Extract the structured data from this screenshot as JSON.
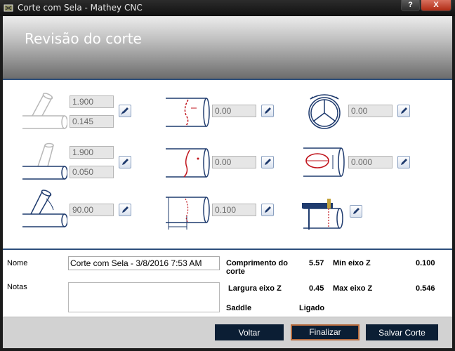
{
  "window": {
    "title": "Corte com Sela - Mathey CNC",
    "help_label": "?",
    "close_label": "X"
  },
  "page": {
    "title": "Revisão do corte"
  },
  "fields": {
    "r1c1_a": "1.900",
    "r1c1_b": "0.145",
    "r2c1_a": "1.900",
    "r2c1_b": "0.050",
    "r3c1": "90.00",
    "r1c2": "0.00",
    "r2c2": "0.00",
    "r3c2": "0.100",
    "r1c3": "0.00",
    "r2c3": "0.000"
  },
  "form": {
    "name_label": "Nome",
    "name_value": "Corte com Sela - 3/8/2016 7:53 AM",
    "notes_label": "Notas",
    "comprimento_label": "Comprimento do corte",
    "comprimento_value": "5.57",
    "largura_label": "Largura eixo Z",
    "largura_value": "0.45",
    "saddle_label": "Saddle",
    "saddle_value": "Ligado",
    "min_z_label": "Min eixo Z",
    "min_z_value": "0.100",
    "max_z_label": "Max eixo Z",
    "max_z_value": "0.546"
  },
  "buttons": {
    "voltar": "Voltar",
    "finalizar": "Finalizar",
    "salvar": "Salvar Corte"
  },
  "colors": {
    "tube_stroke": "#1f3b6e",
    "cut_red": "#c0141c",
    "footer_button": "#0b1e34",
    "accent_line": "#2d4f7c"
  }
}
